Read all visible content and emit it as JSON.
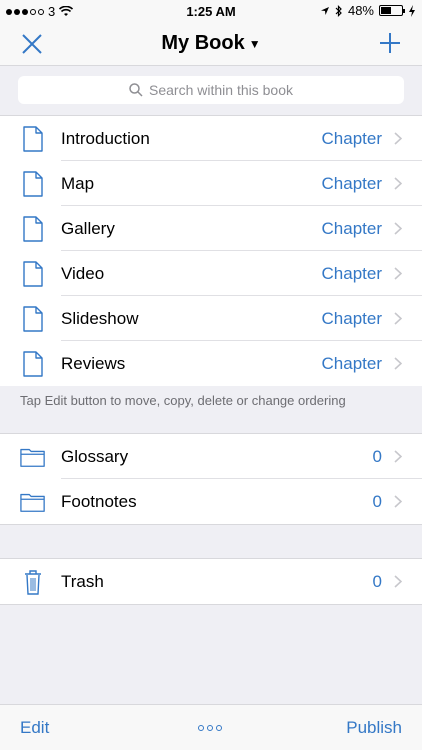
{
  "status": {
    "carrier": "3",
    "time": "1:25 AM",
    "battery_percent": "48%",
    "battery_level": 0.48
  },
  "nav": {
    "title": "My Book",
    "close_icon": "close-x-icon",
    "add_icon": "plus-icon"
  },
  "search": {
    "placeholder": "Search within this book"
  },
  "chapters": [
    {
      "label": "Introduction",
      "type": "Chapter"
    },
    {
      "label": "Map",
      "type": "Chapter"
    },
    {
      "label": "Gallery",
      "type": "Chapter"
    },
    {
      "label": "Video",
      "type": "Chapter"
    },
    {
      "label": "Slideshow",
      "type": "Chapter"
    },
    {
      "label": "Reviews",
      "type": "Chapter"
    }
  ],
  "hint": "Tap Edit button to move, copy, delete or change ordering",
  "folders": [
    {
      "label": "Glossary",
      "count": "0"
    },
    {
      "label": "Footnotes",
      "count": "0"
    }
  ],
  "trash": {
    "label": "Trash",
    "count": "0"
  },
  "toolbar": {
    "edit_label": "Edit",
    "publish_label": "Publish"
  },
  "colors": {
    "accent": "#3478c6",
    "background": "#efeff4"
  }
}
